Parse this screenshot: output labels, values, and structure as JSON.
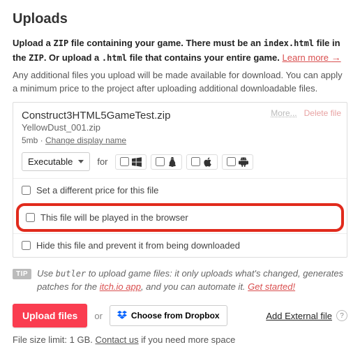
{
  "heading": "Uploads",
  "intro": {
    "part1": "Upload a ",
    "zip": "ZIP",
    "part2": " file containing your game. There must be an ",
    "indexhtml": "index.html",
    "part3": " file in the ",
    "zip2": "ZIP",
    "part4": ". Or upload a ",
    "html": ".html",
    "part5": " file that contains your entire game. ",
    "learn_more": "Learn more",
    "arrow": "→"
  },
  "subtext": "Any additional files you upload will be made available for download. You can apply a minimum price to the project after uploading additional downloadable files.",
  "file": {
    "more": "More...",
    "delete": "Delete file",
    "name": "Construct3HTML5GameTest.zip",
    "subname": "YellowDust_001.zip",
    "size": "5mb",
    "sep": " · ",
    "change_name": "Change display name",
    "select_value": "Executable",
    "for": "for",
    "opt_price": "Set a different price for this file",
    "opt_browser": "This file will be played in the browser",
    "opt_hide": "Hide this file and prevent it from being downloaded"
  },
  "tip": {
    "badge": "TIP",
    "part1": "Use ",
    "butler": "butler",
    "part2": " to upload game files: it only uploads what's changed, generates patches for the ",
    "app_link": "itch.io app",
    "part3": ", and you can automate it. ",
    "get_started": "Get started!"
  },
  "actions": {
    "upload": "Upload files",
    "or": "or",
    "dropbox": "Choose from Dropbox",
    "add_external": "Add External file",
    "q": "?"
  },
  "limit": {
    "part1": "File size limit: 1 GB. ",
    "contact": "Contact us",
    "part2": " if you need more space"
  }
}
